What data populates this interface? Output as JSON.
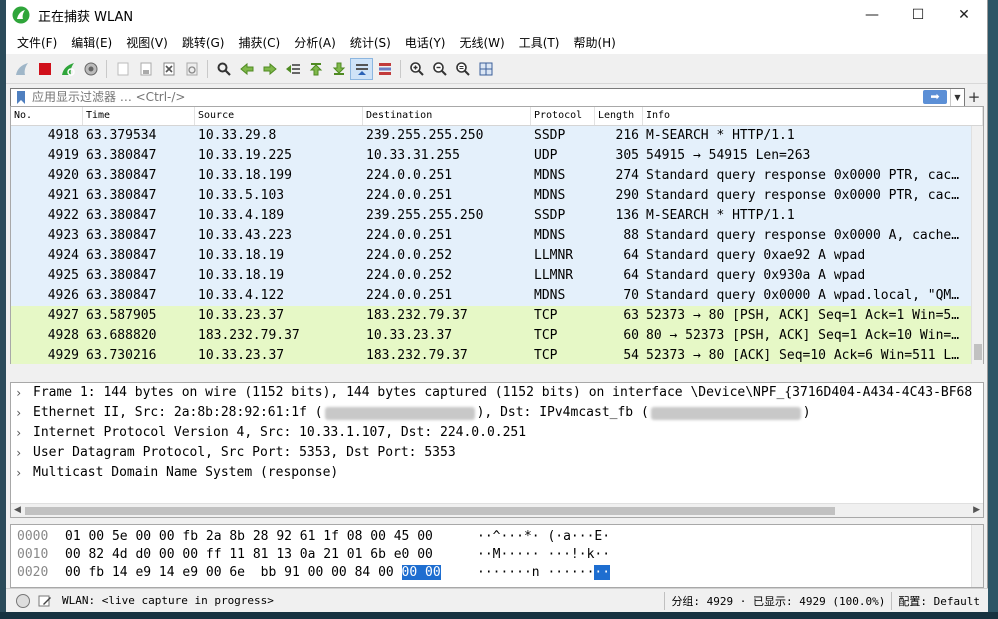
{
  "window": {
    "title": "正在捕获 WLAN",
    "controls": {
      "minimize": "—",
      "maximize": "☐",
      "close": "✕"
    }
  },
  "menu": [
    "文件(F)",
    "编辑(E)",
    "视图(V)",
    "跳转(G)",
    "捕获(C)",
    "分析(A)",
    "统计(S)",
    "电话(Y)",
    "无线(W)",
    "工具(T)",
    "帮助(H)"
  ],
  "filter": {
    "placeholder": "应用显示过滤器 … <Ctrl-/>",
    "apply_arrow": "➡",
    "dropdown": "▼",
    "add": "+"
  },
  "packet_list": {
    "columns": [
      "No.",
      "Time",
      "Source",
      "Destination",
      "Protocol",
      "Length",
      "Info"
    ],
    "rows": [
      {
        "no": "4918",
        "time": "63.379534",
        "src": "10.33.29.8",
        "dst": "239.255.255.250",
        "proto": "SSDP",
        "len": "216",
        "info": "M-SEARCH * HTTP/1.1",
        "color": "#e4f0fb"
      },
      {
        "no": "4919",
        "time": "63.380847",
        "src": "10.33.19.225",
        "dst": "10.33.31.255",
        "proto": "UDP",
        "len": "305",
        "info": "54915 → 54915 Len=263",
        "color": "#e4f0fb"
      },
      {
        "no": "4920",
        "time": "63.380847",
        "src": "10.33.18.199",
        "dst": "224.0.0.251",
        "proto": "MDNS",
        "len": "274",
        "info": "Standard query response 0x0000 PTR, cac…",
        "color": "#e4f0fb"
      },
      {
        "no": "4921",
        "time": "63.380847",
        "src": "10.33.5.103",
        "dst": "224.0.0.251",
        "proto": "MDNS",
        "len": "290",
        "info": "Standard query response 0x0000 PTR, cac…",
        "color": "#e4f0fb"
      },
      {
        "no": "4922",
        "time": "63.380847",
        "src": "10.33.4.189",
        "dst": "239.255.255.250",
        "proto": "SSDP",
        "len": "136",
        "info": "M-SEARCH * HTTP/1.1",
        "color": "#e4f0fb"
      },
      {
        "no": "4923",
        "time": "63.380847",
        "src": "10.33.43.223",
        "dst": "224.0.0.251",
        "proto": "MDNS",
        "len": "88",
        "info": "Standard query response 0x0000 A, cache…",
        "color": "#e4f0fb"
      },
      {
        "no": "4924",
        "time": "63.380847",
        "src": "10.33.18.19",
        "dst": "224.0.0.252",
        "proto": "LLMNR",
        "len": "64",
        "info": "Standard query 0xae92 A wpad",
        "color": "#e4f0fb"
      },
      {
        "no": "4925",
        "time": "63.380847",
        "src": "10.33.18.19",
        "dst": "224.0.0.252",
        "proto": "LLMNR",
        "len": "64",
        "info": "Standard query 0x930a A wpad",
        "color": "#e4f0fb"
      },
      {
        "no": "4926",
        "time": "63.380847",
        "src": "10.33.4.122",
        "dst": "224.0.0.251",
        "proto": "MDNS",
        "len": "70",
        "info": "Standard query 0x0000 A wpad.local, \"QM…",
        "color": "#e4f0fb"
      },
      {
        "no": "4927",
        "time": "63.587905",
        "src": "10.33.23.37",
        "dst": "183.232.79.37",
        "proto": "TCP",
        "len": "63",
        "info": "52373 → 80 [PSH, ACK] Seq=1 Ack=1 Win=5…",
        "color": "#e6f8c6"
      },
      {
        "no": "4928",
        "time": "63.688820",
        "src": "183.232.79.37",
        "dst": "10.33.23.37",
        "proto": "TCP",
        "len": "60",
        "info": "80 → 52373 [PSH, ACK] Seq=1 Ack=10 Win=…",
        "color": "#e6f8c6"
      },
      {
        "no": "4929",
        "time": "63.730216",
        "src": "10.33.23.37",
        "dst": "183.232.79.37",
        "proto": "TCP",
        "len": "54",
        "info": "52373 → 80 [ACK] Seq=10 Ack=6 Win=511 L…",
        "color": "#e6f8c6"
      }
    ]
  },
  "details": {
    "chevron": "›",
    "frame": "Frame 1: 144 bytes on wire (1152 bits), 144 bytes captured (1152 bits) on interface \\Device\\NPF_{3716D404-A434-4C43-BF68",
    "eth_pre": "Ethernet II, Src: 2a:8b:28:92:61:1f (",
    "eth_mid": "), Dst: IPv4mcast_fb (",
    "eth_post": ")",
    "ip": "Internet Protocol Version 4, Src: 10.33.1.107, Dst: 224.0.0.251",
    "udp": "User Datagram Protocol, Src Port: 5353, Dst Port: 5353",
    "mdns": "Multicast Domain Name System (response)"
  },
  "hex": {
    "rows": [
      {
        "offset": "0000",
        "bytes": "01 00 5e 00 00 fb 2a 8b  28 92 61 1f 08 00 45 00",
        "ascii": "··^···*· (·a···E·"
      },
      {
        "offset": "0010",
        "bytes": "00 82 4d d0 00 00 ff 11  81 13 0a 21 01 6b e0 00",
        "ascii": "··M····· ···!·k··"
      },
      {
        "offset": "0020",
        "bytes_plain": "00 fb 14 e9 14 e9 00 6e  bb 91 00 00 84 00 ",
        "bytes_sel": "00 00",
        "ascii_plain": "·······n ······",
        "ascii_sel": "··"
      }
    ]
  },
  "status": {
    "text": "WLAN: <live capture in progress>",
    "packets": "分组: 4929 · 已显示: 4929 (100.0%)",
    "profile": "配置: Default"
  },
  "colors": {
    "udp_row": "#e4f0fb",
    "tcp_row": "#e6f8c6",
    "selection": "#1e6ed0",
    "accent_green": "#2fa53a"
  }
}
